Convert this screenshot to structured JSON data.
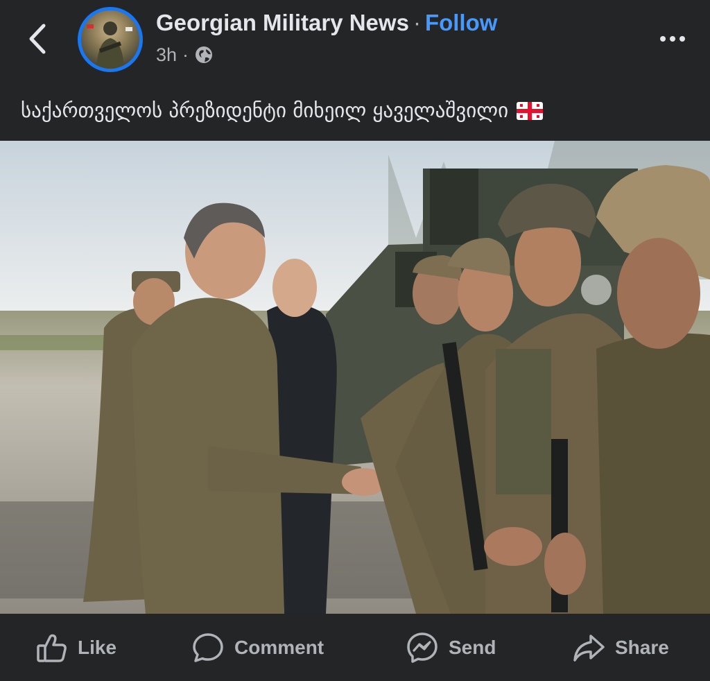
{
  "header": {
    "page_name": "Georgian Military News",
    "separator": "·",
    "follow_label": "Follow",
    "time_ago": "3h",
    "meta_separator": "·",
    "audience_icon": "globe-icon",
    "back_icon": "chevron-left-icon",
    "more_icon": "more-horizontal-icon"
  },
  "post": {
    "caption": "საქართველოს პრეზიდენტი მიხეილ ყაველაშვილი",
    "caption_emoji": "georgia-flag-icon",
    "photo_icon": "photo"
  },
  "actions": [
    {
      "label": "Like",
      "icon": "thumbs-up-icon"
    },
    {
      "label": "Comment",
      "icon": "comment-bubble-icon"
    },
    {
      "label": "Send",
      "icon": "messenger-icon"
    },
    {
      "label": "Share",
      "icon": "share-arrow-icon"
    }
  ],
  "colors": {
    "background": "#242527",
    "text_primary": "#e4e6eb",
    "text_secondary": "#b0b3b8",
    "accent": "#4599ff",
    "avatar_ring": "#1877f2"
  }
}
